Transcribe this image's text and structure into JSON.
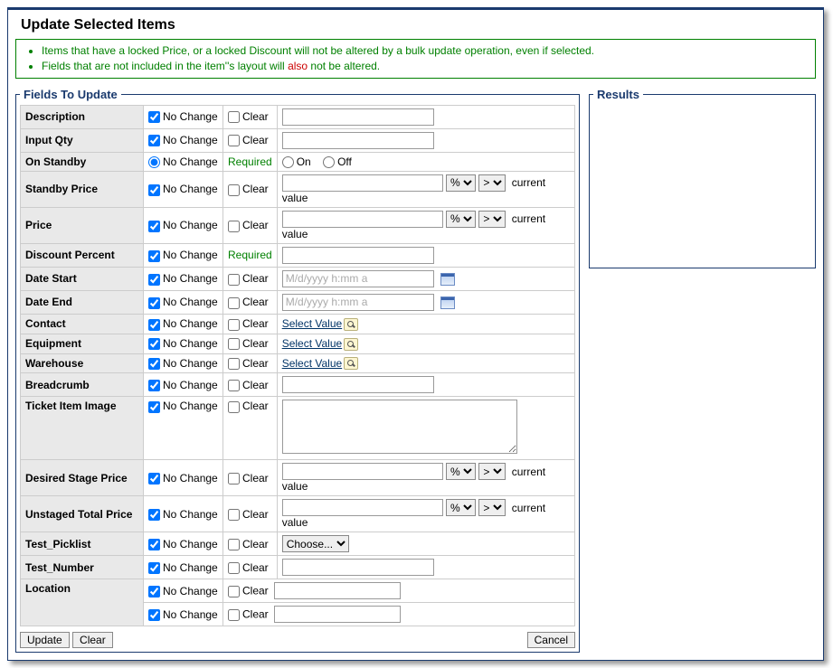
{
  "title": "Update Selected Items",
  "notice": {
    "line1": "Items that have a locked Price, or a locked Discount will not be altered by a bulk update operation, even if selected.",
    "line2_a": "Fields that are not included in the item''s layout will ",
    "line2_also": "also",
    "line2_b": " not be altered."
  },
  "legends": {
    "fields": "Fields To Update",
    "results": "Results"
  },
  "common": {
    "nochange": "No Change",
    "clear": "Clear",
    "required": "Required",
    "select_value": "Select Value",
    "percent": "%",
    "gt": ">",
    "curval": "current value",
    "choose": "Choose...",
    "date_ph": "M/d/yyyy h:mm a",
    "on": "On",
    "off": "Off"
  },
  "rows": {
    "description": "Description",
    "input_qty": "Input Qty",
    "on_standby": "On Standby",
    "standby_price": "Standby Price",
    "price": "Price",
    "discount_percent": "Discount Percent",
    "date_start": "Date Start",
    "date_end": "Date End",
    "contact": "Contact",
    "equipment": "Equipment",
    "warehouse": "Warehouse",
    "breadcrumb": "Breadcrumb",
    "ticket_item_image": "Ticket Item Image",
    "desired_stage_price": "Desired Stage Price",
    "unstaged_total_price": "Unstaged Total Price",
    "test_picklist": "Test_Picklist",
    "test_number": "Test_Number",
    "location": "Location"
  },
  "buttons": {
    "update": "Update",
    "clear": "Clear",
    "cancel": "Cancel"
  }
}
